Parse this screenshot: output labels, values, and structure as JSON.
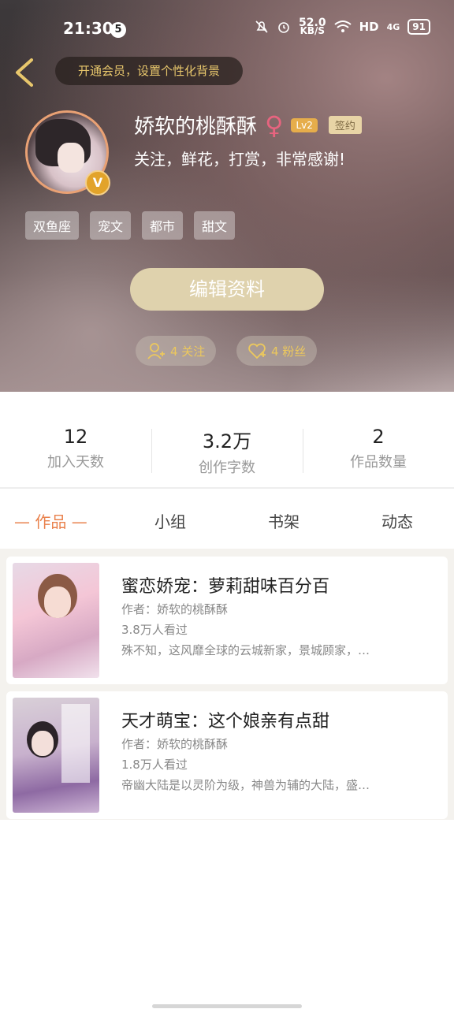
{
  "status_bar": {
    "time": "21:30",
    "notif_count": "5",
    "net_speed": "52.0",
    "net_unit": "KB/S",
    "hd": "HD",
    "signal": "4G",
    "battery": "91"
  },
  "header": {
    "vip_prompt": "开通会员，设置个性化背景",
    "username": "娇软的桃酥酥",
    "gender_symbol": "♀",
    "level": "Lv2",
    "signed_badge": "签约",
    "bio": "关注，鲜花，打赏，非常感谢!",
    "tags": [
      "双鱼座",
      "宠文",
      "都市",
      "甜文"
    ],
    "edit_button": "编辑资料",
    "following": "4 关注",
    "followers": "4 粉丝",
    "verified_mark": "V"
  },
  "stats": [
    {
      "value": "12",
      "label": "加入天数"
    },
    {
      "value": "3.2万",
      "label": "创作字数"
    },
    {
      "value": "2",
      "label": "作品数量"
    }
  ],
  "tabs": {
    "works": "— 作品 —",
    "groups": "小组",
    "bookshelf": "书架",
    "activity": "动态"
  },
  "books": [
    {
      "title": "蜜恋娇宠：萝莉甜味百分百",
      "author": "作者：娇软的桃酥酥",
      "reads": "3.8万人看过",
      "desc": "殊不知，这风靡全球的云城新家，景城顾家，…"
    },
    {
      "title": "天才萌宝：这个娘亲有点甜",
      "author": "作者：娇软的桃酥酥",
      "reads": "1.8万人看过",
      "desc": "帝幽大陆是以灵阶为级，神兽为辅的大陆，盛…"
    }
  ],
  "colors": {
    "accent": "#e9814c",
    "gold": "#ecc85d",
    "button": "#dfd2ad"
  }
}
